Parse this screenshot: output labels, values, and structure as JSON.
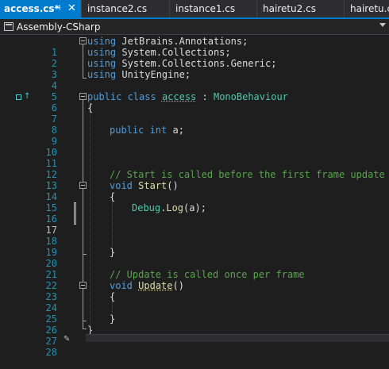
{
  "tabs": [
    {
      "label": "access.cs*",
      "active": true,
      "pin_icon": "pin-icon",
      "close_icon": "close-icon"
    },
    {
      "label": "instance2.cs"
    },
    {
      "label": "instance1.cs"
    },
    {
      "label": "hairetu2.cs"
    },
    {
      "label": "hairetu.cs"
    }
  ],
  "navbar": {
    "project": "Assembly-CSharp",
    "icon": "csharp-project-icon",
    "dropdown_icon": "chevron-down-icon"
  },
  "colors": {
    "accent": "#007acc",
    "keyword": "#569cd6",
    "type": "#4ec9b0",
    "comment": "#57a64a",
    "method": "#dcdcaa",
    "line_number": "#2b91af"
  },
  "editor": {
    "lines": [
      {
        "n": "1"
      },
      {
        "n": "2"
      },
      {
        "n": "3"
      },
      {
        "n": "4"
      },
      {
        "n": "5"
      },
      {
        "n": "6"
      },
      {
        "n": "7"
      },
      {
        "n": "8"
      },
      {
        "n": "9"
      },
      {
        "n": "10"
      },
      {
        "n": "11"
      },
      {
        "n": "12"
      },
      {
        "n": "13"
      },
      {
        "n": "14"
      },
      {
        "n": "15"
      },
      {
        "n": "16"
      },
      {
        "n": "17"
      },
      {
        "n": "18"
      },
      {
        "n": "19"
      },
      {
        "n": "20"
      },
      {
        "n": "21"
      },
      {
        "n": "22"
      },
      {
        "n": "23"
      },
      {
        "n": "24"
      },
      {
        "n": "25"
      },
      {
        "n": "26"
      },
      {
        "n": "27"
      },
      {
        "n": "28"
      }
    ],
    "code": {
      "l1_kw": "using",
      "l1_rest": " JetBrains.Annotations;",
      "l2_kw": "using",
      "l2_rest": " System.Collections;",
      "l3_kw": "using",
      "l3_rest": " System.Collections.Generic;",
      "l4_kw": "using",
      "l4_rest": " UnityEngine;",
      "l6_kw": "public class",
      "l6_name": "access",
      "l6_colon": " : ",
      "l6_base": "MonoBehaviour",
      "l7": "{",
      "l9_kw": "public int",
      "l9_rest": " a;",
      "l13": "// Start is called before the first frame update",
      "l14_kw": "void",
      "l14_name": "Start",
      "l14_rest": "()",
      "l15": "{",
      "l16_type": "Debug",
      "l16_dot": ".",
      "l16_method": "Log",
      "l16_rest": "(a);",
      "l20": "}",
      "l22": "// Update is called once per frame",
      "l23_kw": "void",
      "l23_name": "Update",
      "l23_rest": "()",
      "l24": "{",
      "l26": "}",
      "l27": "}"
    }
  }
}
